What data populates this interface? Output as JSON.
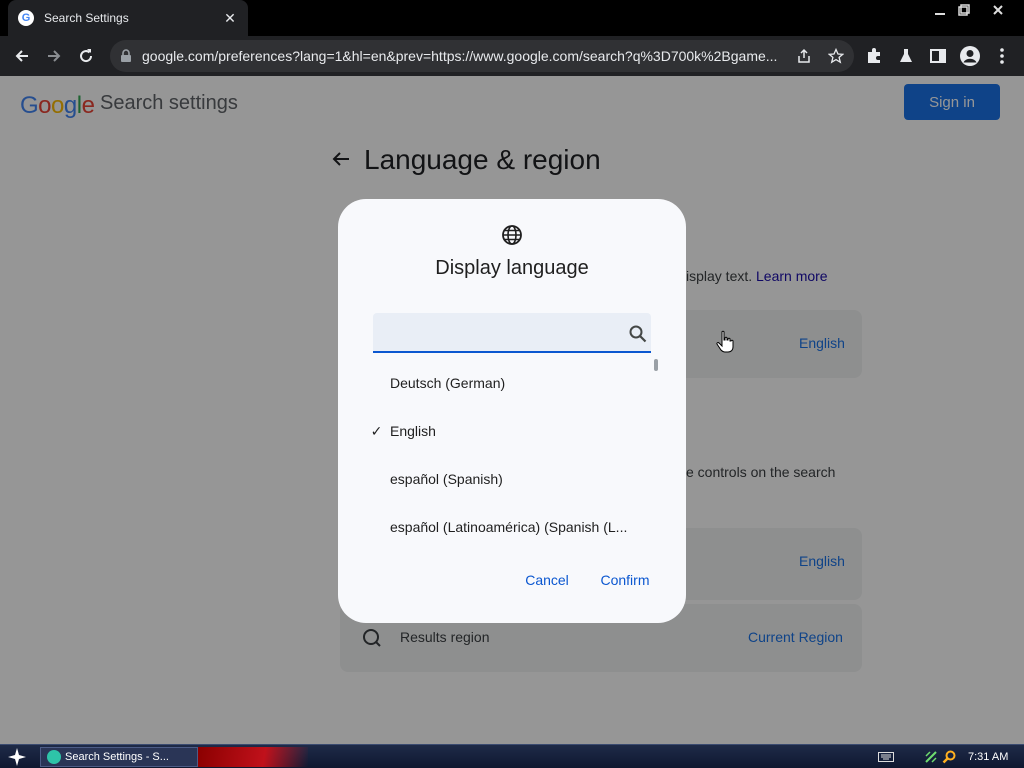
{
  "browser": {
    "tab_title": "Search Settings",
    "favicon_letter": "G",
    "url": "google.com/preferences?lang=1&hl=en&prev=https://www.google.com/search?q%3D700k%2Bgame..."
  },
  "page": {
    "logo_text": [
      "G",
      "o",
      "o",
      "g",
      "l",
      "e"
    ],
    "title": "Search settings",
    "sign_in_label": "Sign in",
    "section_title": "Language & region",
    "bg_fragments": {
      "display_text": "isplay text.",
      "learn_more": "Learn more",
      "english_1": "English",
      "controls_text": "e controls on the search",
      "english_2": "English",
      "results_region_label": "Results region",
      "results_region_value": "Current Region"
    }
  },
  "dialog": {
    "title": "Display language",
    "search_placeholder": "",
    "search_value": "",
    "languages": [
      {
        "label": "Deutsch  (German)",
        "selected": false
      },
      {
        "label": "English",
        "selected": true
      },
      {
        "label": "español  (Spanish)",
        "selected": false
      },
      {
        "label": "español (Latinoamérica)  (Spanish (L...",
        "selected": false
      }
    ],
    "cancel_label": "Cancel",
    "confirm_label": "Confirm",
    "check_glyph": "✓"
  },
  "taskbar": {
    "task_label": "Search Settings - S...",
    "clock": "7:31 AM"
  },
  "colors": {
    "google_blue": "#4285f4",
    "google_red": "#ea4335",
    "google_yellow": "#fbbc05",
    "google_green": "#34a853",
    "accent": "#0b57d0",
    "sign_in_bg": "#1a73e8"
  }
}
